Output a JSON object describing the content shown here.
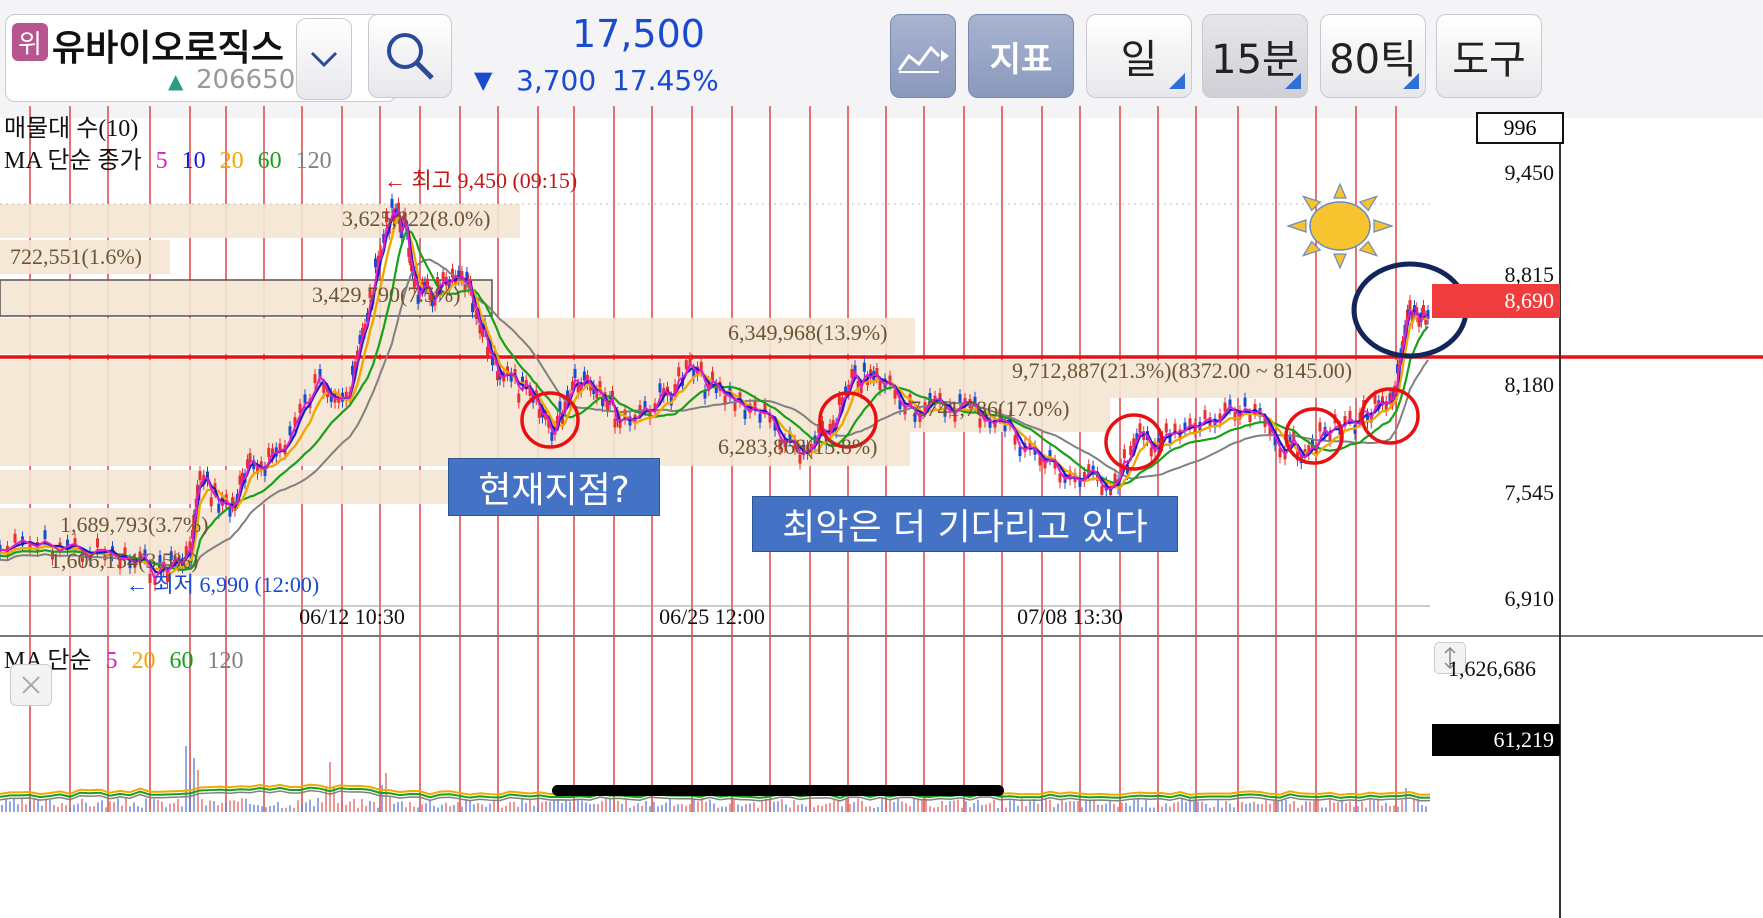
{
  "stock": {
    "badge": "위",
    "name": "유바이오로직스",
    "code": "206650"
  },
  "quote": {
    "price": "17,500",
    "change_arrow": "▼",
    "change": "3,700",
    "change_pct": "17.45%"
  },
  "toolbar": {
    "indicator_label": "지표",
    "period_day": "일",
    "period_min": "15분",
    "period_tick": "80틱",
    "tools": "도구"
  },
  "chart": {
    "volume_profile_label": "매물대 수(10)",
    "ma_title": "MA 단순 종가",
    "ma_periods": [
      "5",
      "10",
      "20",
      "60",
      "120"
    ],
    "high_label": "← 최고 9,450 (09:15)",
    "low_label": "← 최저 6,990 (12:00)",
    "y_ticks": [
      "9,450",
      "8,815",
      "8,180",
      "7,545",
      "6,910"
    ],
    "top_box": "996",
    "current_price_tag": "8,690",
    "x_ticks": [
      "06/12 10:30",
      "06/25 12:00",
      "07/08 13:30"
    ],
    "profile_labels": [
      "3,625,822(8.0%)",
      "722,551(1.6%)",
      "3,429,790(7.5%)",
      "6,349,968(13.9%)",
      "9,712,887(21.3%)(8372.00 ~ 8145.00)",
      "7,741,786(17.0%)",
      "6,283,868(13.8%)",
      "1,689,793(3.7%)",
      "1,606,154(3.5%)"
    ]
  },
  "callouts": {
    "current_point": "현재지점?",
    "worst_waiting": "최악은 더 기다리고 있다"
  },
  "lower": {
    "ma_title": "MA 단순",
    "ma_periods": [
      "5",
      "20",
      "60",
      "120"
    ],
    "top_value": "1,626,686",
    "current_value": "61,219"
  },
  "colors": {
    "ma5": "#e020c0",
    "ma10": "#1a1acc",
    "ma20": "#f0a800",
    "ma60": "#18a018",
    "ma120": "#808080",
    "down": "#1a4ad0",
    "accent_red": "#e81010",
    "callout_bg": "#4472c4",
    "profile_bg": "#f5e6d3"
  },
  "icons": [
    "chevron-down-icon",
    "search-icon",
    "line-chart-icon",
    "sun-icon",
    "resize-icon",
    "close-icon",
    "alert-icon"
  ]
}
